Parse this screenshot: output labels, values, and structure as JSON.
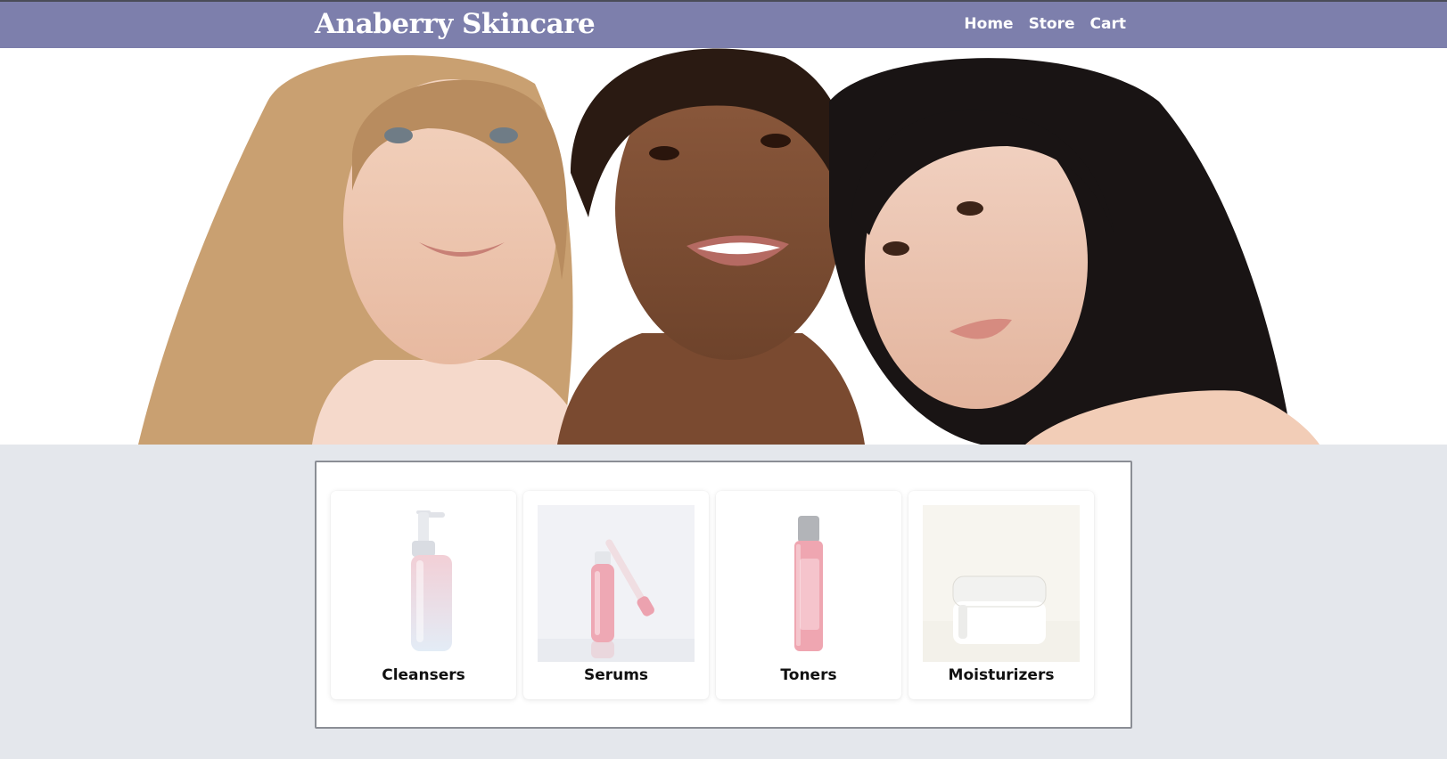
{
  "header": {
    "brand": "Anaberry Skincare",
    "nav": [
      {
        "label": "Home",
        "icon": null
      },
      {
        "label": "Store",
        "icon": null
      },
      {
        "label": "Cart",
        "icon": null
      }
    ]
  },
  "hero": {
    "image": "three-women-portrait-photo"
  },
  "categories": [
    {
      "label": "Cleansers",
      "image": "pump-bottle-photo"
    },
    {
      "label": "Serums",
      "image": "dropper-bottle-photo"
    },
    {
      "label": "Toners",
      "image": "toner-bottle-photo"
    },
    {
      "label": "Moisturizers",
      "image": "cream-jar-photo"
    }
  ],
  "colors": {
    "navbar": "#7d7fac",
    "page_background": "#e4e7ec",
    "panel_border": "#8b8e95",
    "brand_text": "#ffffff"
  }
}
